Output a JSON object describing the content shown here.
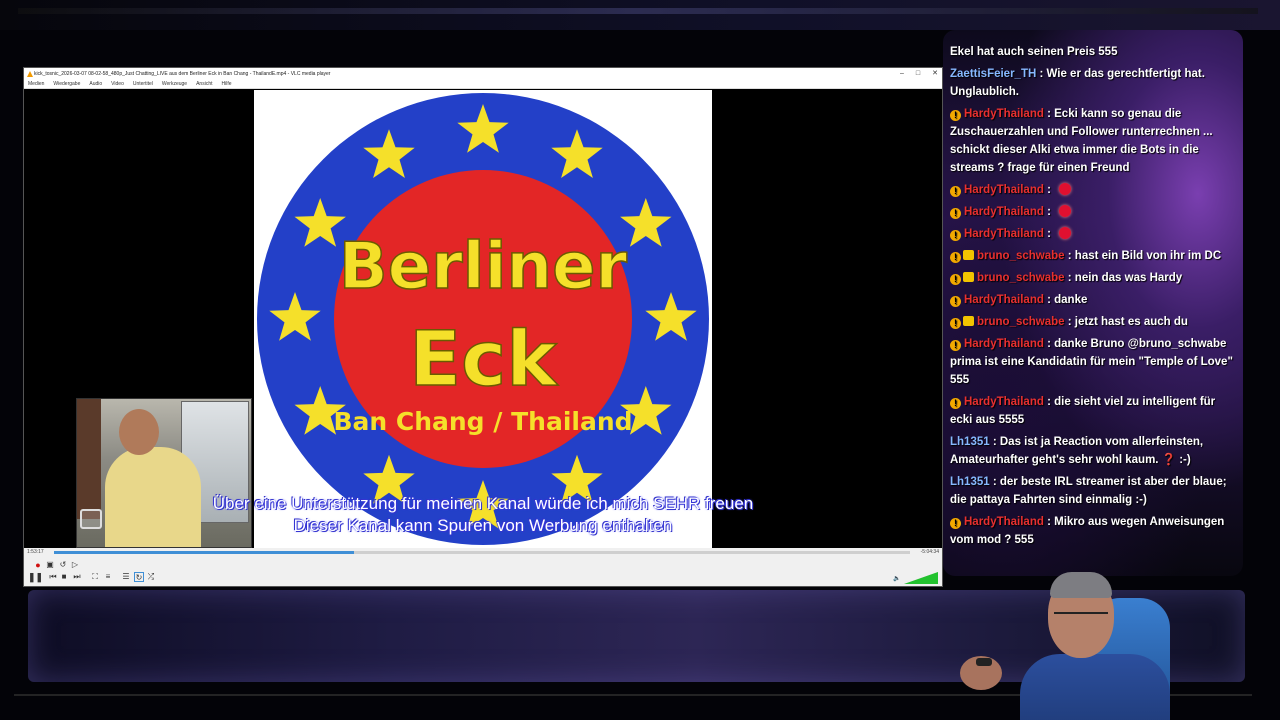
{
  "vlc": {
    "window_title": "kick_tosnic_2026-03-07 08-02-58_480p_Just Chatting_LIVE aus dem Berliner Eck in Ban Chang - ThailandE.mp4 - VLC media player",
    "menu": [
      "Medien",
      "Wiedergabe",
      "Audio",
      "Video",
      "Untertitel",
      "Werkzeuge",
      "Ansicht",
      "Hilfe"
    ],
    "logo": {
      "line1": "Berliner",
      "line2": "Eck",
      "line3": "Ban Chang / Thailand",
      "colors": {
        "outer": "#2340c8",
        "inner": "#e32626",
        "text": "#f5e02a",
        "stars": "#f5e02a"
      }
    },
    "subtitles": {
      "line1": "Über eine Unterstützung für meinen Kanal würde ich mich SEHR freuen",
      "line2": "Dieser Kanal kann Spuren von Werbung enthalten"
    },
    "time_elapsed": "1:53:17",
    "time_remaining": "-5:04:34",
    "progress_fraction": 0.35,
    "volume_fraction": 1.0,
    "icons": {
      "record": "record-icon",
      "snapshot": "snapshot-icon",
      "pause": "pause-icon",
      "prev": "prev-icon",
      "next": "next-icon",
      "fullscreen": "fullscreen-icon",
      "playlist": "playlist-icon",
      "loop": "loop-icon",
      "shuffle": "shuffle-icon",
      "volume": "volume-icon"
    }
  },
  "chat": {
    "messages": [
      {
        "user": "",
        "style": "none",
        "badges": 0,
        "text": "Ekel hat auch seinen Preis 555"
      },
      {
        "user": "ZaettisFeier_TH",
        "style": "blue",
        "badges": 0,
        "text": "Wie er das gerechtfertigt hat. Unglaublich."
      },
      {
        "user": "HardyThailand",
        "style": "red",
        "badges": 1,
        "text": "Ecki kann so genau die Zuschauerzahlen und Follower runterrechnen ... schickt dieser Alki etwa immer die Bots in die streams ? frage für einen Freund"
      },
      {
        "user": "HardyThailand",
        "style": "red",
        "badges": 1,
        "text": "",
        "emote": true
      },
      {
        "user": "HardyThailand",
        "style": "red",
        "badges": 1,
        "text": "",
        "emote": true
      },
      {
        "user": "HardyThailand",
        "style": "red",
        "badges": 1,
        "text": "",
        "emote": true
      },
      {
        "user": "bruno_schwabe",
        "style": "red",
        "badges": 2,
        "text": "hast ein Bild von ihr im DC"
      },
      {
        "user": "bruno_schwabe",
        "style": "red",
        "badges": 2,
        "text": "nein das was Hardy"
      },
      {
        "user": "HardyThailand",
        "style": "red",
        "badges": 1,
        "text": "danke"
      },
      {
        "user": "bruno_schwabe",
        "style": "red",
        "badges": 2,
        "text": "jetzt hast es auch du"
      },
      {
        "user": "HardyThailand",
        "style": "red",
        "badges": 1,
        "text": "danke Bruno @bruno_schwabe prima ist eine Kandidatin für mein \"Temple of Love\" 555"
      },
      {
        "user": "HardyThailand",
        "style": "red",
        "badges": 1,
        "text": "die sieht viel zu intelligent für ecki aus 5555"
      },
      {
        "user": "Lh1351",
        "style": "blue",
        "badges": 0,
        "text": "Das ist ja Reaction vom allerfeinsten, Amateurhafter geht's sehr wohl kaum. ❓ :-)"
      },
      {
        "user": "Lh1351",
        "style": "blue",
        "badges": 0,
        "text": "der beste IRL streamer ist aber der blaue; die pattaya Fahrten sind einmalig :-)"
      },
      {
        "user": "HardyThailand",
        "style": "red",
        "badges": 1,
        "text": "Mikro aus wegen Anweisungen vom mod ? 555"
      }
    ]
  }
}
